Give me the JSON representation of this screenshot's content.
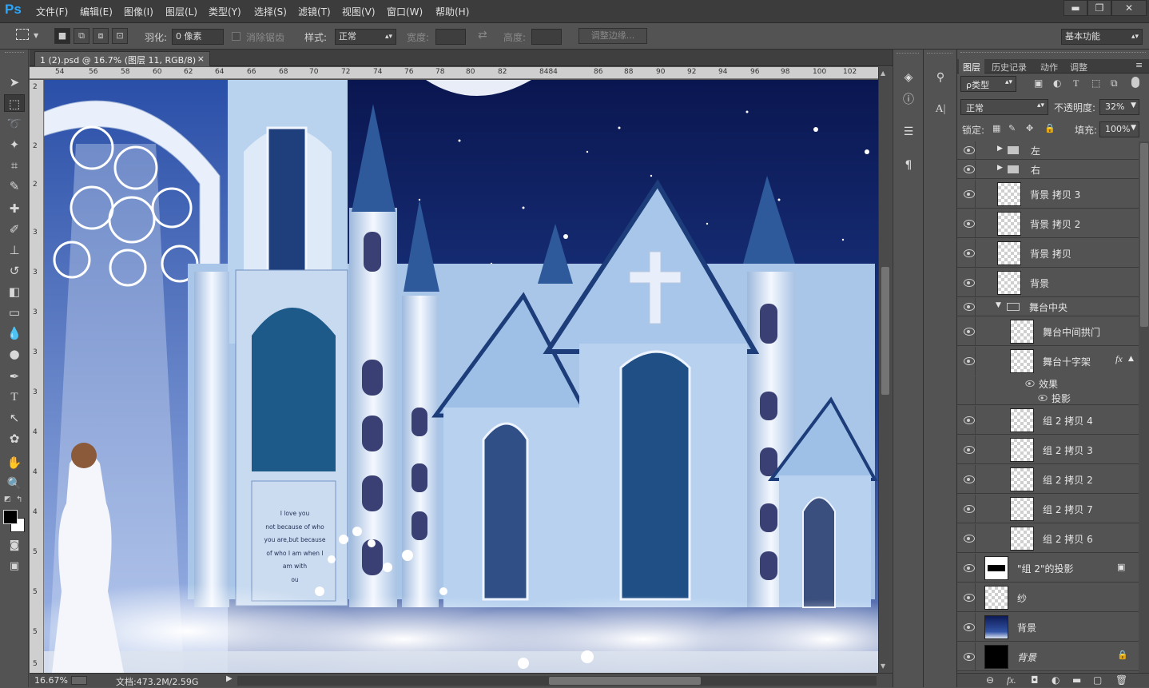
{
  "app": {
    "logo": "Ps"
  },
  "menu": [
    "文件(F)",
    "编辑(E)",
    "图像(I)",
    "图层(L)",
    "类型(Y)",
    "选择(S)",
    "滤镜(T)",
    "视图(V)",
    "窗口(W)",
    "帮助(H)"
  ],
  "window_controls": {
    "minimize": "▬",
    "restore": "❐",
    "close": "✕"
  },
  "options": {
    "feather_label": "羽化:",
    "feather_value": "0 像素",
    "antialias_label": "消除锯齿",
    "style_label": "样式:",
    "style_value": "正常",
    "width_label": "宽度:",
    "height_label": "高度:",
    "refine_edge": "调整边缘...",
    "workspace": "基本功能"
  },
  "document": {
    "tab_title": "1 (2).psd @ 16.7% (图层 11, RGB/8)",
    "close": "×",
    "ruler_h": [
      "54",
      "56",
      "58",
      "60",
      "62",
      "64",
      "66",
      "68",
      "70",
      "72",
      "74",
      "76",
      "78",
      "80",
      "82",
      "8484",
      "86",
      "88",
      "90",
      "92",
      "94",
      "96",
      "98",
      "100",
      "102"
    ],
    "ruler_v": [
      "2",
      "2",
      "2",
      "3",
      "3",
      "3",
      "3",
      "3",
      "4",
      "4",
      "4",
      "5",
      "5",
      "5",
      "5"
    ],
    "zoom": "16.67%",
    "doc_size": "文档:473.2M/2.59G",
    "canvas_text": [
      "I love you",
      "not because of who",
      "you are,but because",
      "of who I am when I",
      "am with",
      "ou"
    ]
  },
  "panel": {
    "tabs": [
      "图层",
      "历史记录",
      "动作",
      "调整"
    ],
    "filter_type": "ρ类型",
    "blend_mode": "正常",
    "opacity_label": "不透明度:",
    "opacity_value": "32%",
    "lock_label": "锁定:",
    "fill_label": "填充:",
    "fill_value": "100%",
    "layers": [
      {
        "name": "左",
        "kind": "group"
      },
      {
        "name": "右",
        "kind": "group"
      },
      {
        "name": "背景 拷贝 3",
        "kind": "layer"
      },
      {
        "name": "背景 拷贝 2",
        "kind": "layer"
      },
      {
        "name": "背景 拷贝",
        "kind": "layer"
      },
      {
        "name": "背景",
        "kind": "layer"
      },
      {
        "name": "舞台中央",
        "kind": "group-open"
      },
      {
        "name": "舞台中间拱门",
        "kind": "sublayer"
      },
      {
        "name": "舞台十字架",
        "kind": "sublayer-fx",
        "fx": "fx"
      },
      {
        "name": "效果",
        "kind": "effect"
      },
      {
        "name": "投影",
        "kind": "effect-item"
      },
      {
        "name": "组 2 拷贝 4",
        "kind": "sublayer"
      },
      {
        "name": "组 2 拷贝 3",
        "kind": "sublayer"
      },
      {
        "name": "组 2 拷贝 2",
        "kind": "sublayer"
      },
      {
        "name": "组 2 拷贝 7",
        "kind": "sublayer"
      },
      {
        "name": "组 2 拷贝 6",
        "kind": "sublayer"
      },
      {
        "name": "\"组 2\"的投影",
        "kind": "layer-dark"
      },
      {
        "name": "纱",
        "kind": "layer"
      },
      {
        "name": "背景",
        "kind": "layer-night"
      },
      {
        "name": "背景",
        "kind": "layer-black",
        "italic": true
      }
    ]
  }
}
